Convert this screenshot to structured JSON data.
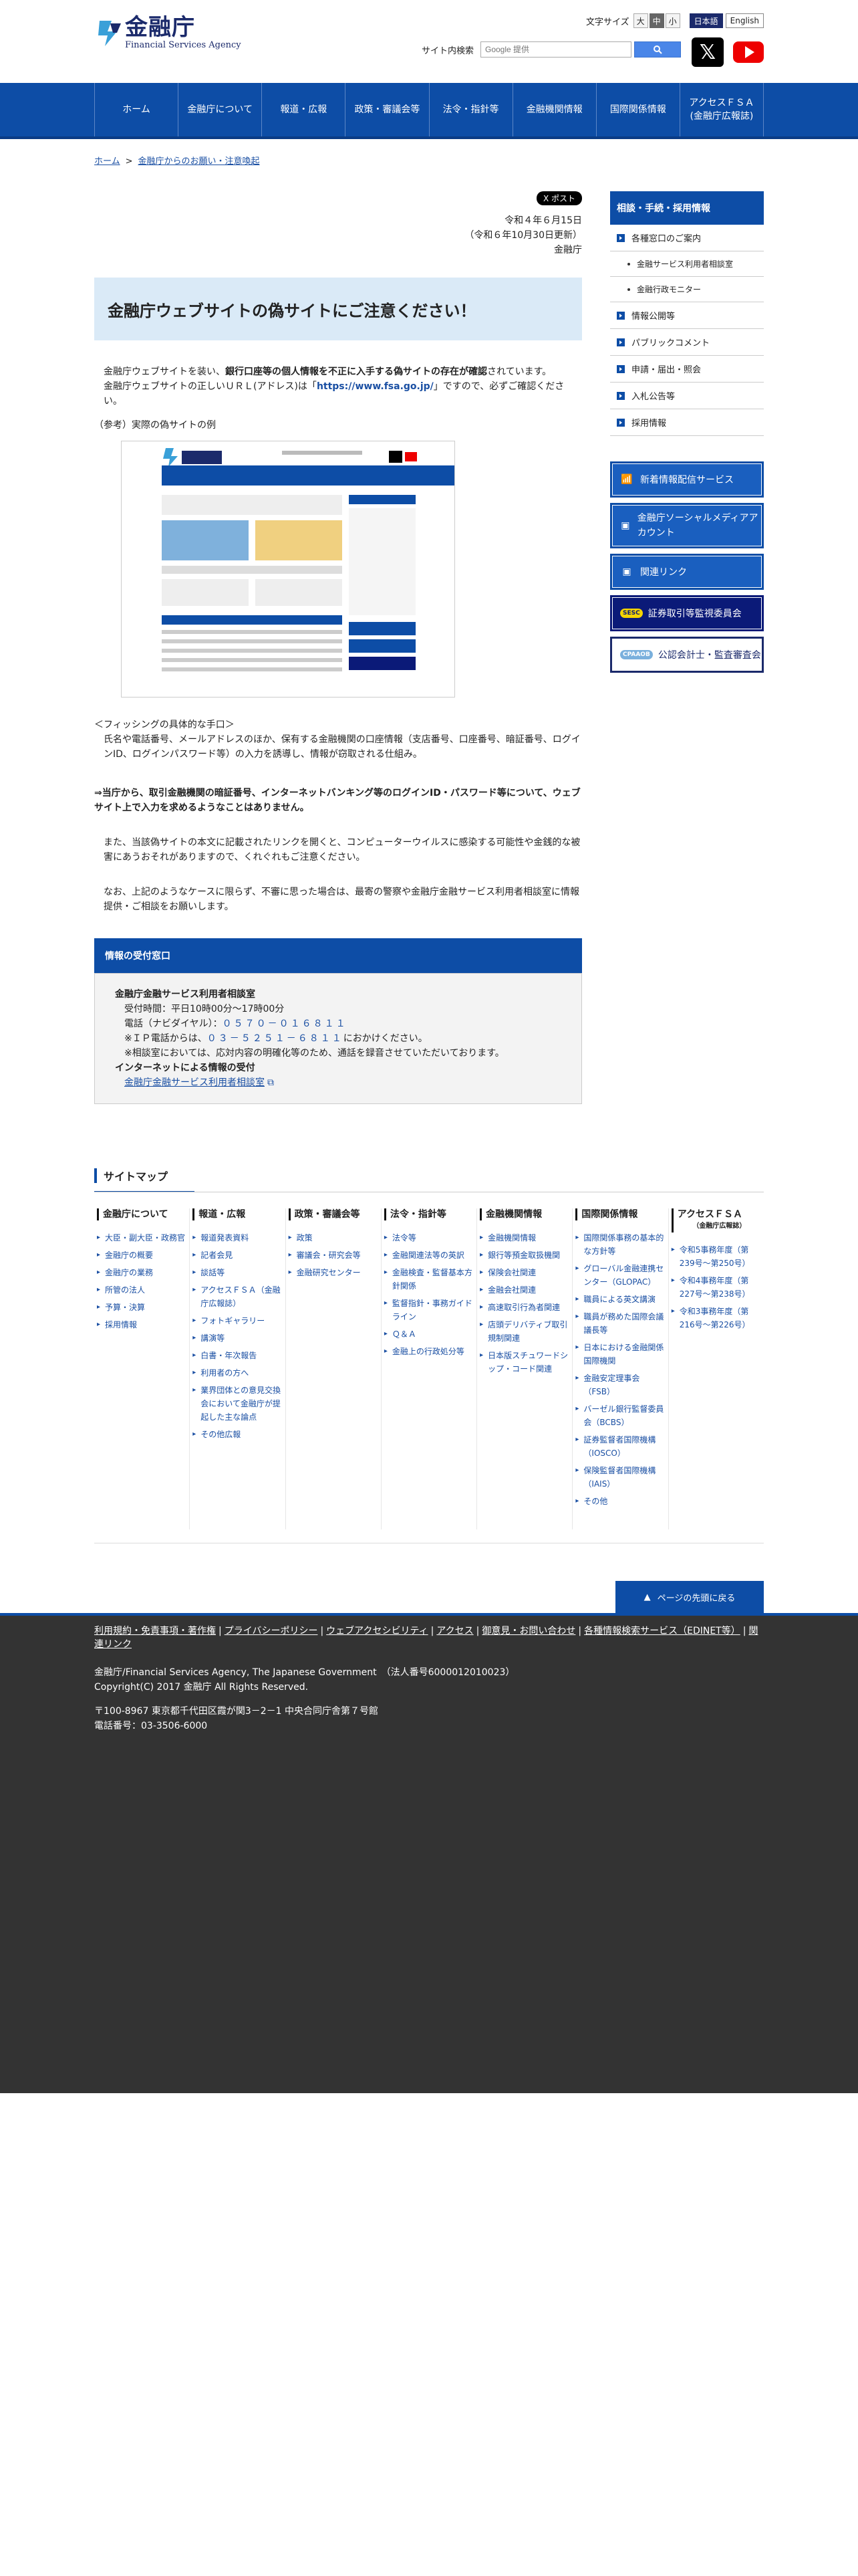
{
  "header": {
    "logo_jp": "金融庁",
    "logo_en": "Financial Services Agency",
    "fontsize_label": "文字サイズ",
    "fontsize_large": "大",
    "fontsize_mid": "中",
    "fontsize_small": "小",
    "lang_jp": "日本語",
    "lang_en": "English",
    "search_label": "サイト内検索",
    "search_placeholder": "Google 提供"
  },
  "nav": [
    "ホーム",
    "金融庁について",
    "報道・広報",
    "政策・審議会等",
    "法令・指針等",
    "金融機関情報",
    "国際関係情報",
    "アクセスＦＳＡ\n(金融庁広報誌)"
  ],
  "breadcrumb": {
    "home": "ホーム",
    "sep": ">",
    "current": "金融庁からのお願い・注意喚起"
  },
  "tweet": "X ポスト",
  "dates": {
    "line1": "令和４年６月15日",
    "line2": "（令和６年10月30日更新）",
    "line3": "金融庁"
  },
  "title": "金融庁ウェブサイトの偽サイトにご注意ください！",
  "para1_a": "金融庁ウェブサイトを装い、",
  "para1_b": "銀行口座等の個人情報を不正に入手する偽サイトの存在が確認",
  "para1_c": "されています。",
  "para1_d": "金融庁ウェブサイトの正しいＵＲＬ(アドレス)は「",
  "para1_url": "https://www.fsa.go.jp/",
  "para1_e": "」ですので、必ずご確認ください。",
  "example_label": "（参考）実際の偽サイトの例",
  "phishing_title": "＜フィッシングの具体的な手口＞",
  "phishing_body": "氏名や電話番号、メールアドレスのほか、保有する金融機関の口座情報（支店番号、口座番号、暗証番号、ログインID、ログインパスワード等）の入力を誘導し、情報が窃取される仕組み。",
  "warning": "⇒当庁から、取引金融機関の暗証番号、インターネットバンキング等のログインID・パスワード等について、ウェブサイト上で入力を求めるようなことはありません。",
  "para_virus": "また、当該偽サイトの本文に記載されたリンクを開くと、コンピューターウイルスに感染する可能性や金銭的な被害にあうおそれがありますので、くれぐれもご注意ください。",
  "para_consult": "なお、上記のようなケースに限らず、不審に思った場合は、最寄の警察や金融庁金融サービス利用者相談室に情報提供・ご相談をお願いします。",
  "contact": {
    "head": "情報の受付窓口",
    "name": "金融庁金融サービス利用者相談室",
    "hours": "受付時間：平日10時00分～17時00分",
    "tel_label": "電話（ナビダイヤル）：",
    "tel": "０５７０－０１６８１１",
    "ip_label": "※ＩＰ電話からは、",
    "ip_tel": "０３－５２５１－６８１１",
    "ip_suffix": "におかけください。",
    "note": "※相談室においては、応対内容の明確化等のため、通話を録音させていただいております。",
    "web_head": "インターネットによる情報の受付",
    "web_link": "金融庁金融サービス利用者相談室"
  },
  "side": {
    "head": "相談・手続・採用情報",
    "items": [
      {
        "label": "各種窓口のご案内",
        "sub": false
      },
      {
        "label": "金融サービス利用者相談室",
        "sub": true
      },
      {
        "label": "金融行政モニター",
        "sub": true
      },
      {
        "label": "情報公開等",
        "sub": false
      },
      {
        "label": "パブリックコメント",
        "sub": false
      },
      {
        "label": "申請・届出・照会",
        "sub": false
      },
      {
        "label": "入札公告等",
        "sub": false
      },
      {
        "label": "採用情報",
        "sub": false
      }
    ],
    "btn_mail": "新着情報配信サービス",
    "btn_social": "金融庁ソーシャルメディアアカウント",
    "btn_links": "関連リンク",
    "btn_sesc_badge": "SESC",
    "btn_sesc": "証券取引等監視委員会",
    "btn_cpaaob_badge": "CPAAOB",
    "btn_cpaaob": "公認会計士・監査審査会"
  },
  "sitemap": {
    "title": "サイトマップ",
    "cols": [
      {
        "h": "金融庁について",
        "sub": "",
        "items": [
          "大臣・副大臣・政務官",
          "金融庁の概要",
          "金融庁の業務",
          "所管の法人",
          "予算・決算",
          "採用情報"
        ]
      },
      {
        "h": "報道・広報",
        "sub": "",
        "items": [
          "報道発表資料",
          "記者会見",
          "談話等",
          "アクセスＦＳＡ（金融庁広報誌）",
          "フォトギャラリー",
          "講演等",
          "白書・年次報告",
          "利用者の方へ",
          "業界団体との意見交換会において金融庁が提起した主な論点",
          "その他広報"
        ]
      },
      {
        "h": "政策・審議会等",
        "sub": "",
        "items": [
          "政策",
          "審議会・研究会等",
          "金融研究センター"
        ]
      },
      {
        "h": "法令・指針等",
        "sub": "",
        "items": [
          "法令等",
          "金融関連法等の英訳",
          "金融検査・監督基本方針関係",
          "監督指針・事務ガイドライン",
          "Ｑ＆Ａ",
          "金融上の行政処分等"
        ]
      },
      {
        "h": "金融機関情報",
        "sub": "",
        "items": [
          "金融機関情報",
          "銀行等預金取扱機関",
          "保険会社関連",
          "金融会社関連",
          "高速取引行為者関連",
          "店頭デリバティブ取引規制関連",
          "日本版スチュワードシップ・コード関連"
        ]
      },
      {
        "h": "国際関係情報",
        "sub": "",
        "items": [
          "国際関係事務の基本的な方針等",
          "グローバル金融連携センター（GLOPAC）",
          "職員による英文講演",
          "職員が務めた国際会議議長等",
          "日本における金融関係国際機関",
          "金融安定理事会（FSB）",
          "バーゼル銀行監督委員会（BCBS）",
          "証券監督者国際機構（IOSCO）",
          "保険監督者国際機構（IAIS）",
          "その他"
        ]
      },
      {
        "h": "アクセスＦＳＡ",
        "sub": "（金融庁広報誌）",
        "items": [
          "令和5事務年度（第239号～第250号）",
          "令和4事務年度（第227号～第238号）",
          "令和3事務年度（第216号～第226号）"
        ]
      }
    ]
  },
  "page_top": "ページの先頭に戻る",
  "footer": {
    "links": [
      "利用規約・免責事項・著作権",
      "プライバシーポリシー",
      "ウェブアクセシビリティ",
      "アクセス",
      "御意見・お問い合わせ",
      "各種情報検索サービス（EDINET等）",
      "関連リンク"
    ],
    "line1": "金融庁/Financial Services Agency, The Japanese Government　（法人番号6000012010023）",
    "line2": "Copyright(C) 2017 金融庁 All Rights Reserved.",
    "line3": "〒100-8967 東京都千代田区霞が関3－2－1 中央合同庁舎第７号館",
    "line4": "電話番号：03-3506-6000"
  },
  "colors": {
    "brand_blue": "#0d4da6",
    "title_bg": "#daeaf7",
    "footer_bg": "#333333"
  }
}
